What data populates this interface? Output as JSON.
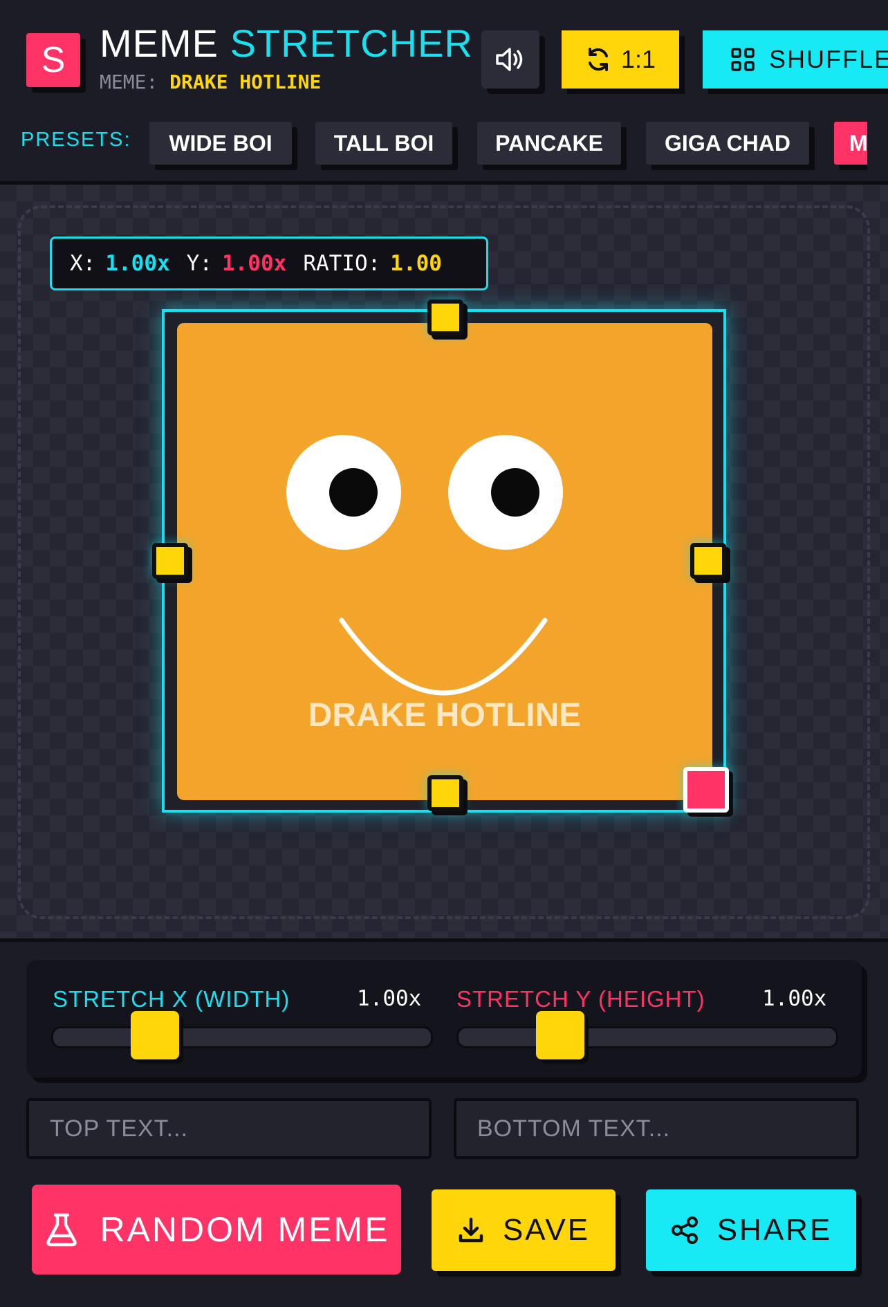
{
  "header": {
    "logo_letter": "S",
    "title_word1": "MEME",
    "title_word2": "STRETCHER",
    "meme_label": "MEME:",
    "meme_name": "DRAKE HOTLINE",
    "sound_icon": "volume-icon",
    "ratio_button": "1:1",
    "ratio_icon": "refresh-icon",
    "shuffle_button": "SHUFFLE",
    "shuffle_icon": "grid-icon"
  },
  "presets": {
    "label": "PRESETS:",
    "items": [
      {
        "label": "WIDE BOI"
      },
      {
        "label": "TALL BOI"
      },
      {
        "label": "PANCAKE"
      },
      {
        "label": "GIGA CHAD"
      },
      {
        "label": "M"
      }
    ],
    "active_index": 4
  },
  "readout": {
    "x_label": "X:",
    "x_value": "1.00x",
    "y_label": "Y:",
    "y_value": "1.00x",
    "ratio_label": "RATIO:",
    "ratio_value": "1.00"
  },
  "meme": {
    "caption": "DRAKE HOTLINE",
    "background": "#f2a52a"
  },
  "sliders": {
    "x": {
      "label": "STRETCH X (WIDTH)",
      "value": "1.00x",
      "fraction": 0.27
    },
    "y": {
      "label": "STRETCH Y (HEIGHT)",
      "value": "1.00x",
      "fraction": 0.27
    }
  },
  "inputs": {
    "top_placeholder": "TOP TEXT...",
    "bottom_placeholder": "BOTTOM TEXT..."
  },
  "actions": {
    "random": "RANDOM MEME",
    "random_icon": "flask-icon",
    "save": "SAVE",
    "save_icon": "download-icon",
    "share": "SHARE",
    "share_icon": "share-icon"
  },
  "colors": {
    "background": "#1b1c25",
    "accent_cyan": "#17e0f0",
    "accent_pink": "#ff3366",
    "accent_yellow": "#ffd60a"
  }
}
